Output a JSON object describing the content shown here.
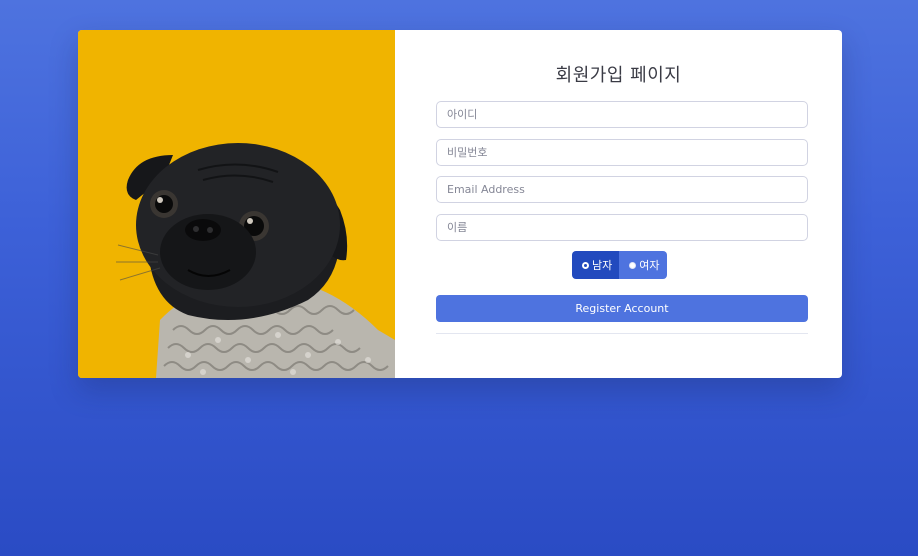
{
  "colors": {
    "background": "#3d61d8",
    "primary": "#4e73df",
    "primary_dark": "#224abe",
    "photo_background": "#f0b400"
  },
  "form": {
    "title": "회원가입 페이지",
    "id_placeholder": "아이디",
    "password_placeholder": "비밀번호",
    "email_placeholder": "Email Address",
    "name_placeholder": "이름",
    "gender": {
      "selected": "남자",
      "options": [
        {
          "label": "남자"
        },
        {
          "label": "여자"
        }
      ]
    },
    "register_label": "Register Account"
  },
  "photo": {
    "icon": "pug-photo"
  }
}
